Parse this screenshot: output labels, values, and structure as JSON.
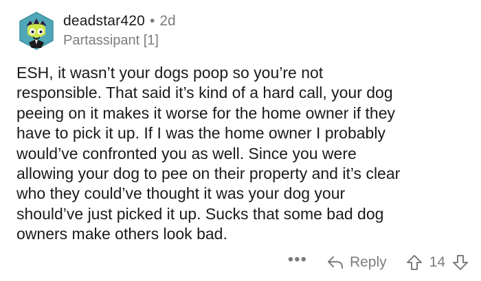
{
  "comment": {
    "username": "deadstar420",
    "separator": "•",
    "age": "2d",
    "flair": "Partassipant [1]",
    "body": "ESH, it wasn’t your dogs poop so you’re not\nresponsible. That said it’s kind of a hard call, your dog\npeeing on it makes it worse for the home owner if they\nhave to pick it up. If I was the home owner I probably\nwould’ve confronted you as well. Since you were\nallowing your dog to pee on their property and it’s clear\nwho they could’ve thought it was your dog your\nshould’ve just picked it up. Sucks that some bad dog\nowners make others look bad."
  },
  "actions": {
    "more_label": "•••",
    "reply_label": "Reply",
    "vote_count": "14"
  },
  "icons": {
    "avatar": "avatar-icon",
    "reply": "reply-arrow-icon",
    "upvote": "upvote-icon",
    "downvote": "downvote-icon"
  },
  "colors": {
    "text": "#1a1a1b",
    "muted": "#7c7c7c",
    "avatar_bg": "#4fa7b8"
  }
}
